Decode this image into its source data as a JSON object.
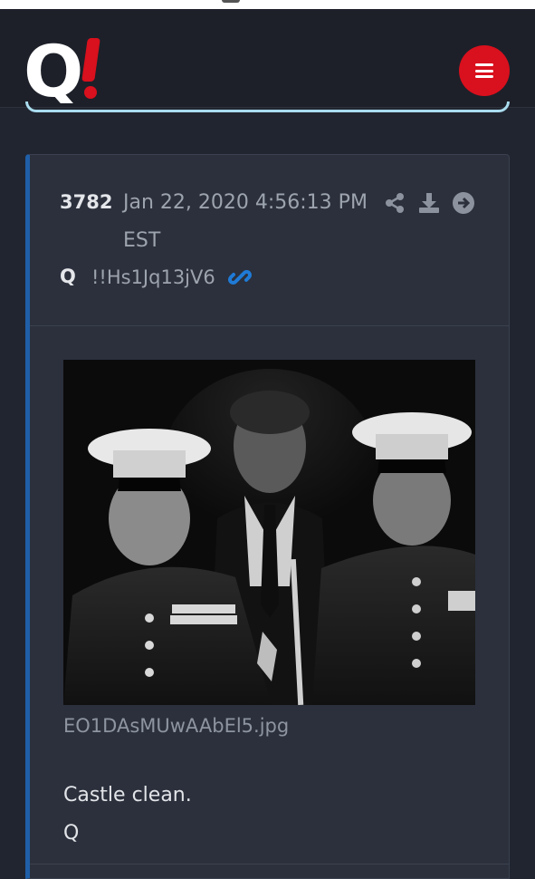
{
  "header": {
    "logo_text": "Q!",
    "menu_icon": "hamburger-menu-icon",
    "accent_color": "#d9101d"
  },
  "post": {
    "number": "3782",
    "date": "Jan 22, 2020 4:56:13 PM EST",
    "author": "Q",
    "tripcode": "!!Hs1Jq13jV6",
    "actions": [
      "share-icon",
      "download-icon",
      "arrow-right-circle-icon"
    ],
    "permalink_icon": "link-icon",
    "image_filename": "EO1DAsMUwAAbEl5.jpg",
    "message_lines": [
      "Castle clean.",
      "Q"
    ],
    "border_accent_color": "#1f5fa8"
  }
}
